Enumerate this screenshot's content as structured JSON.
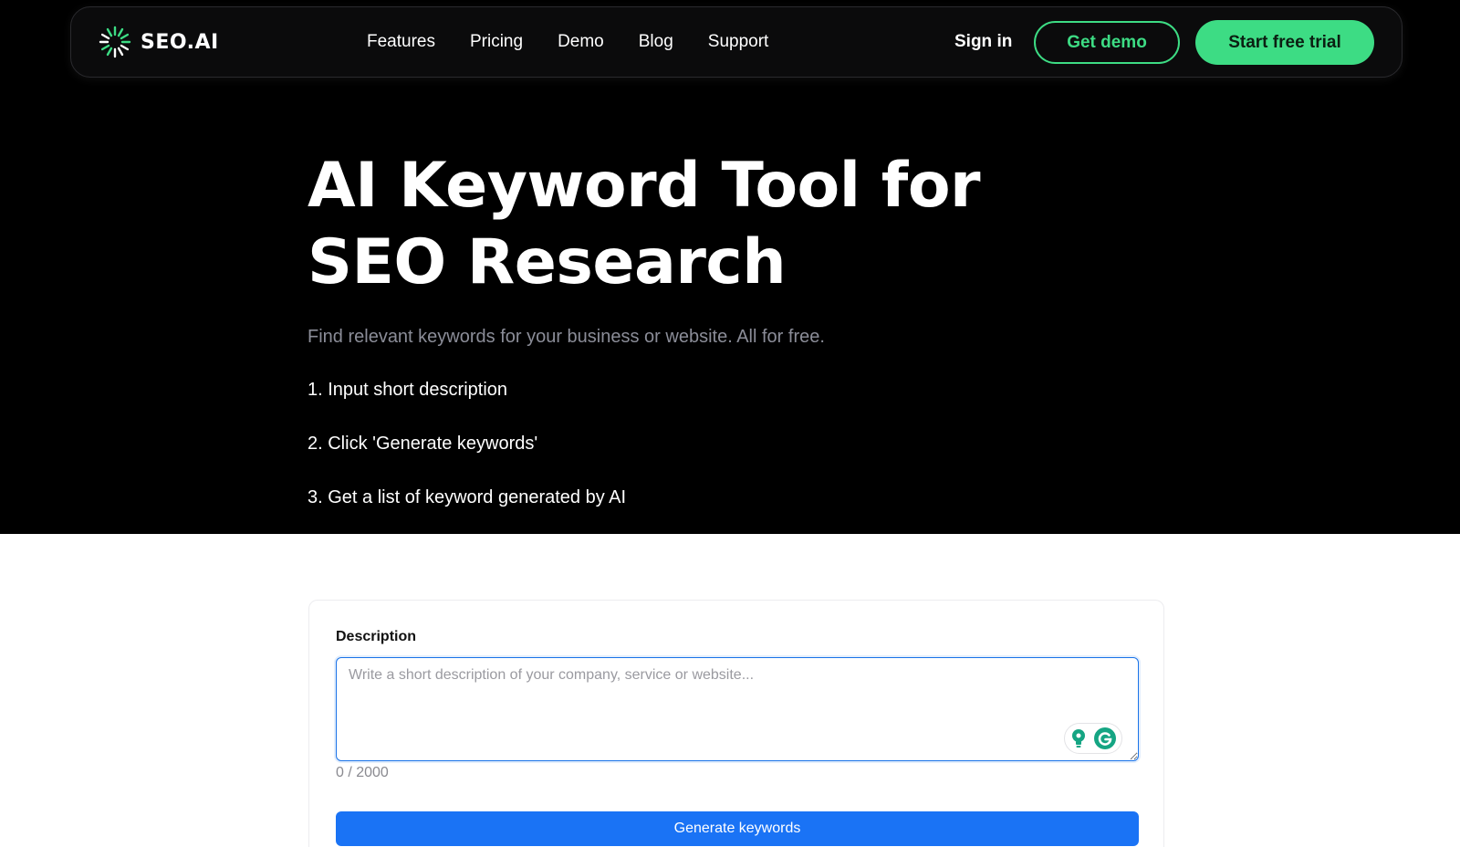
{
  "brand": {
    "name": "SEO.AI",
    "accent_color": "#3ddc84"
  },
  "nav": {
    "links": [
      "Features",
      "Pricing",
      "Demo",
      "Blog",
      "Support"
    ],
    "sign_in": "Sign in",
    "get_demo": "Get demo",
    "start_trial": "Start free trial"
  },
  "hero": {
    "title": "AI Keyword Tool for SEO Research",
    "subtitle": "Find relevant keywords for your business or website. All for free.",
    "steps": [
      "1. Input short description",
      "2. Click 'Generate keywords'",
      "3. Get a list of keyword generated by AI"
    ]
  },
  "form": {
    "label": "Description",
    "placeholder": "Write a short description of your company, service or website...",
    "value": "",
    "char_count": "0 / 2000",
    "submit_label": "Generate keywords",
    "button_color": "#1a73f5"
  },
  "icons": {
    "logo": "sunburst-logo-icon",
    "grammarly_hint": "lightbulb-icon",
    "grammarly": "grammarly-icon"
  }
}
